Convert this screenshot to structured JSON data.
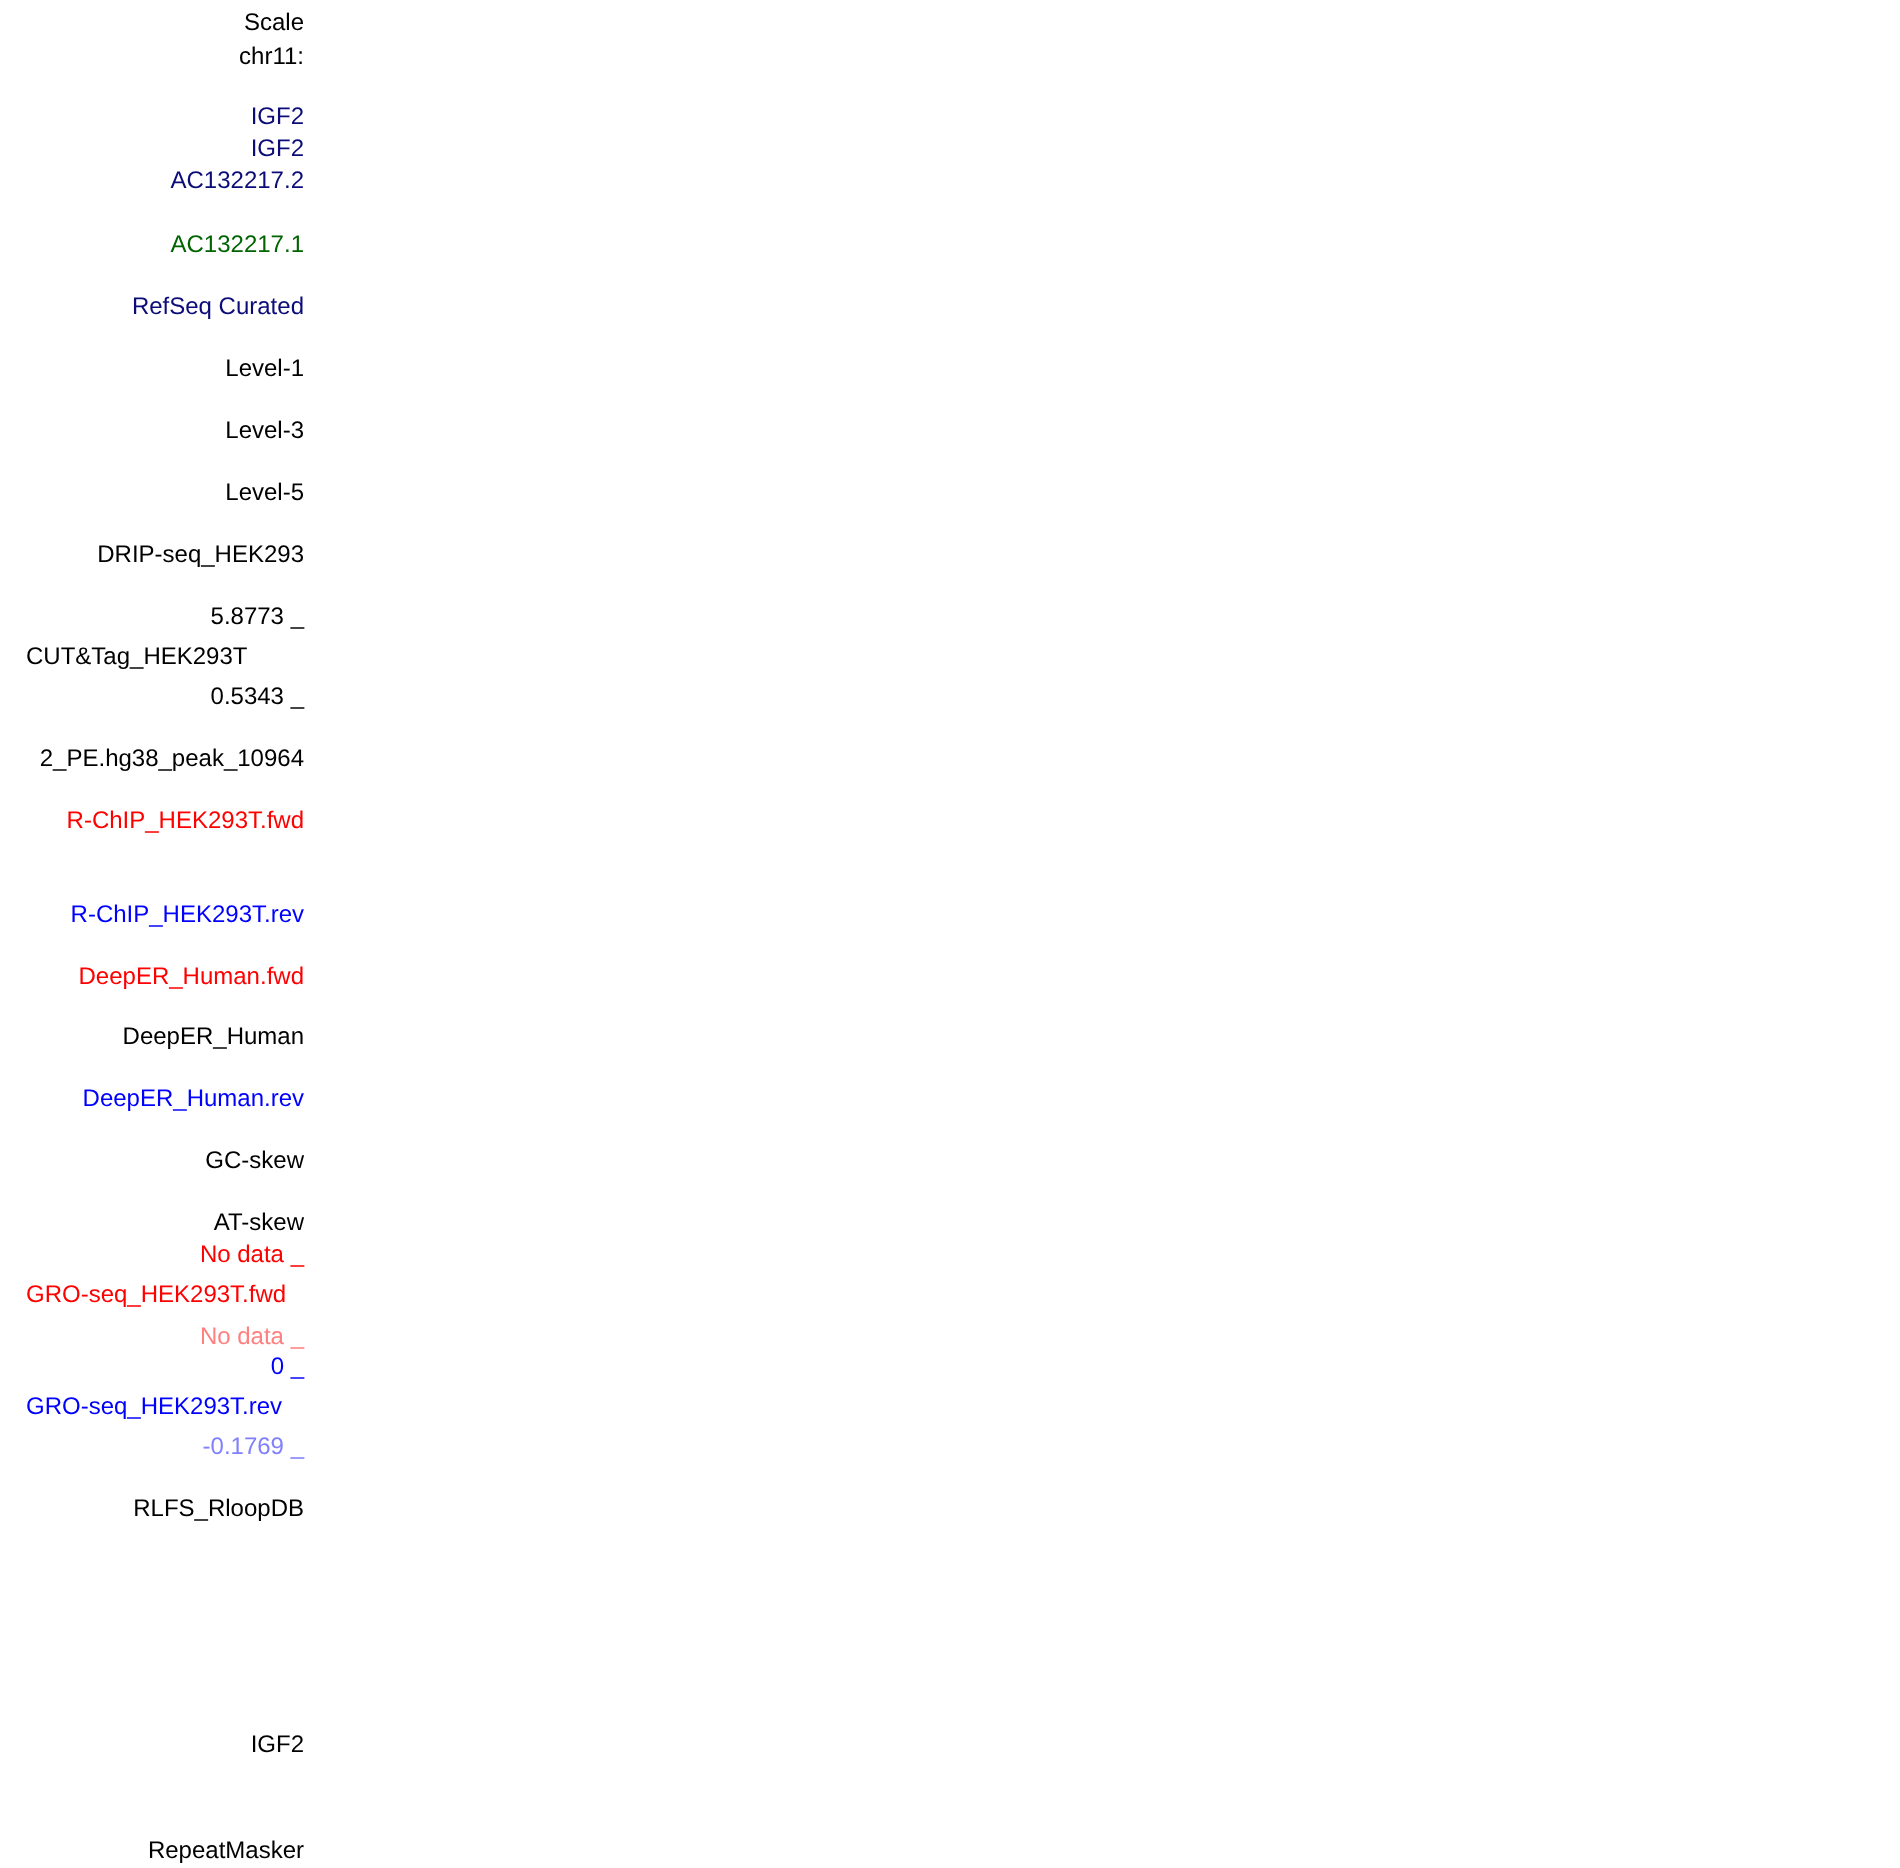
{
  "labels": [
    {
      "text": "Scale",
      "kind": "name",
      "color": "#000000"
    },
    {
      "text": "chr11:",
      "kind": "name",
      "color": "#000000"
    },
    {
      "text": "IGF2",
      "kind": "name",
      "color": "#0c0c78"
    },
    {
      "text": "IGF2",
      "kind": "name",
      "color": "#0c0c78"
    },
    {
      "text": "AC132217.2",
      "kind": "name",
      "color": "#0c0c78"
    },
    {
      "text": "AC132217.1",
      "kind": "name",
      "color": "#006400"
    },
    {
      "text": "RefSeq Curated",
      "kind": "name",
      "color": "#0c0c78"
    },
    {
      "text": "Level-1",
      "kind": "name",
      "color": "#000000"
    },
    {
      "text": "Level-3",
      "kind": "name",
      "color": "#000000"
    },
    {
      "text": "Level-5",
      "kind": "name",
      "color": "#000000"
    },
    {
      "text": "DRIP-seq_HEK293",
      "kind": "name",
      "color": "#000000"
    },
    {
      "text": "5.8773 _",
      "kind": "range",
      "color": "#000000"
    },
    {
      "text": "CUT&Tag_HEK293T",
      "kind": "title",
      "color": "#000000"
    },
    {
      "text": "0.5343 _",
      "kind": "range",
      "color": "#000000"
    },
    {
      "text": "2_PE.hg38_peak_10964",
      "kind": "name",
      "color": "#000000"
    },
    {
      "text": "R-ChIP_HEK293T.fwd",
      "kind": "name",
      "color": "#ff0000"
    },
    {
      "text": "R-ChIP_HEK293T.rev",
      "kind": "name",
      "color": "#0000ff"
    },
    {
      "text": "DeepER_Human.fwd",
      "kind": "name",
      "color": "#ff0000"
    },
    {
      "text": "DeepER_Human",
      "kind": "name",
      "color": "#000000"
    },
    {
      "text": "DeepER_Human.rev",
      "kind": "name",
      "color": "#0000ff"
    },
    {
      "text": "GC-skew",
      "kind": "name",
      "color": "#000000"
    },
    {
      "text": "AT-skew",
      "kind": "name",
      "color": "#000000"
    },
    {
      "text": "No data _",
      "kind": "range",
      "color": "#ff0000"
    },
    {
      "text": "GRO-seq_HEK293T.fwd",
      "kind": "title",
      "color": "#ff0000"
    },
    {
      "text": "No data _",
      "kind": "range",
      "color": "#ff8080"
    },
    {
      "text": "0 _",
      "kind": "range",
      "color": "#0000ff"
    },
    {
      "text": "GRO-seq_HEK293T.rev",
      "kind": "title",
      "color": "#0000ff"
    },
    {
      "text": "-0.1769 _",
      "kind": "range",
      "color": "#8080ff"
    },
    {
      "text": "RLFS_RloopDB",
      "kind": "name",
      "color": "#000000"
    },
    {
      "text": "IGF2",
      "kind": "name",
      "color": "#000000"
    },
    {
      "text": "RepeatMasker",
      "kind": "name",
      "color": "#000000"
    }
  ]
}
